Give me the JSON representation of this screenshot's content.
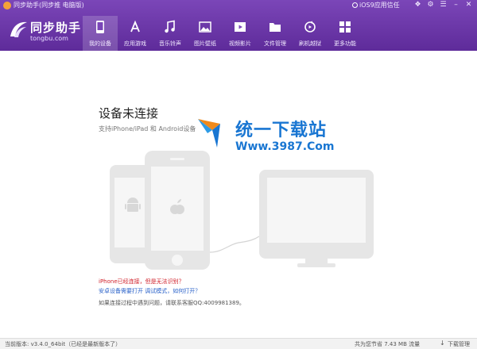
{
  "titlebar": {
    "window_title": "同步助手(同步推 电脑版)",
    "ios_trust": "iOS9应用信任",
    "icons": [
      "shirt-icon",
      "tool-icon",
      "menu-icon",
      "minimize-icon",
      "close-icon"
    ]
  },
  "logo": {
    "name": "同步助手",
    "domain": "tongbu.com"
  },
  "nav": {
    "items": [
      {
        "label": "我的设备",
        "icon": "phone-icon",
        "active": true
      },
      {
        "label": "应用游戏",
        "icon": "appstore-icon"
      },
      {
        "label": "音乐铃声",
        "icon": "music-icon"
      },
      {
        "label": "图片壁纸",
        "icon": "image-icon"
      },
      {
        "label": "视频影片",
        "icon": "video-icon"
      },
      {
        "label": "文件管理",
        "icon": "folder-icon"
      },
      {
        "label": "刷机越狱",
        "icon": "refresh-icon"
      },
      {
        "label": "更多功能",
        "icon": "grid-icon"
      }
    ]
  },
  "main": {
    "title": "设备未连接",
    "subtitle": "支持iPhone/iPad 和 Android设备",
    "link_iphone": "iPhone已经连接，但是无法识别？",
    "link_android": "安卓设备需要打开 调试模式，如何打开？",
    "support_note": "如果连接过程中遇到问题，请联系客服QQ:4009981389。"
  },
  "watermark": {
    "text": "统一下载站",
    "url": "Www.3987.Com"
  },
  "status": {
    "version": "当前版本: v3.4.0_64bit（已经是最新版本了）",
    "saved": "共为您节省  7.43 MB 流量",
    "download_manage": "下载管理"
  },
  "colors": {
    "header": "#6a35a8",
    "link_red": "#d0202a",
    "link_blue": "#2a62c9",
    "device_gray": "#e6e6e6"
  }
}
